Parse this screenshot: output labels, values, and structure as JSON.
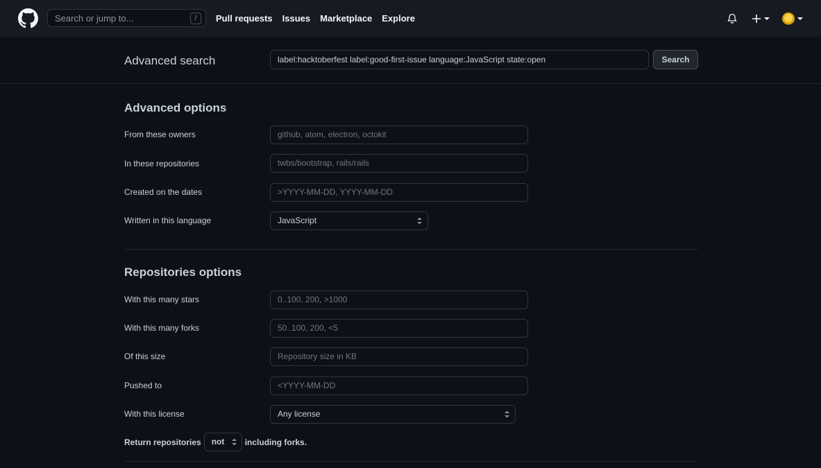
{
  "nav": {
    "search_placeholder": "Search or jump to...",
    "search_shortcut": "/",
    "links": [
      "Pull requests",
      "Issues",
      "Marketplace",
      "Explore"
    ]
  },
  "header": {
    "title": "Advanced search",
    "query": "label:hacktoberfest label:good-first-issue language:JavaScript state:open",
    "search_button": "Search"
  },
  "advanced": {
    "title": "Advanced options",
    "owners_label": "From these owners",
    "owners_placeholder": "github, atom, electron, octokit",
    "repos_label": "In these repositories",
    "repos_placeholder": "twbs/bootstrap, rails/rails",
    "dates_label": "Created on the dates",
    "dates_placeholder": ">YYYY-MM-DD, YYYY-MM-DD",
    "language_label": "Written in this language",
    "language_value": "JavaScript"
  },
  "repositories": {
    "title": "Repositories options",
    "stars_label": "With this many stars",
    "stars_placeholder": "0..100, 200, >1000",
    "forks_label": "With this many forks",
    "forks_placeholder": "50..100, 200, <5",
    "size_label": "Of this size",
    "size_placeholder": "Repository size in KB",
    "pushed_label": "Pushed to",
    "pushed_placeholder": "<YYYY-MM-DD",
    "license_label": "With this license",
    "license_value": "Any license",
    "return_prefix": "Return repositories",
    "return_value": "not",
    "return_suffix": "including forks."
  },
  "colors": {
    "background": "#0d1117",
    "nav_background": "#161b22",
    "border": "#30363d",
    "text": "#c9d1d9"
  }
}
